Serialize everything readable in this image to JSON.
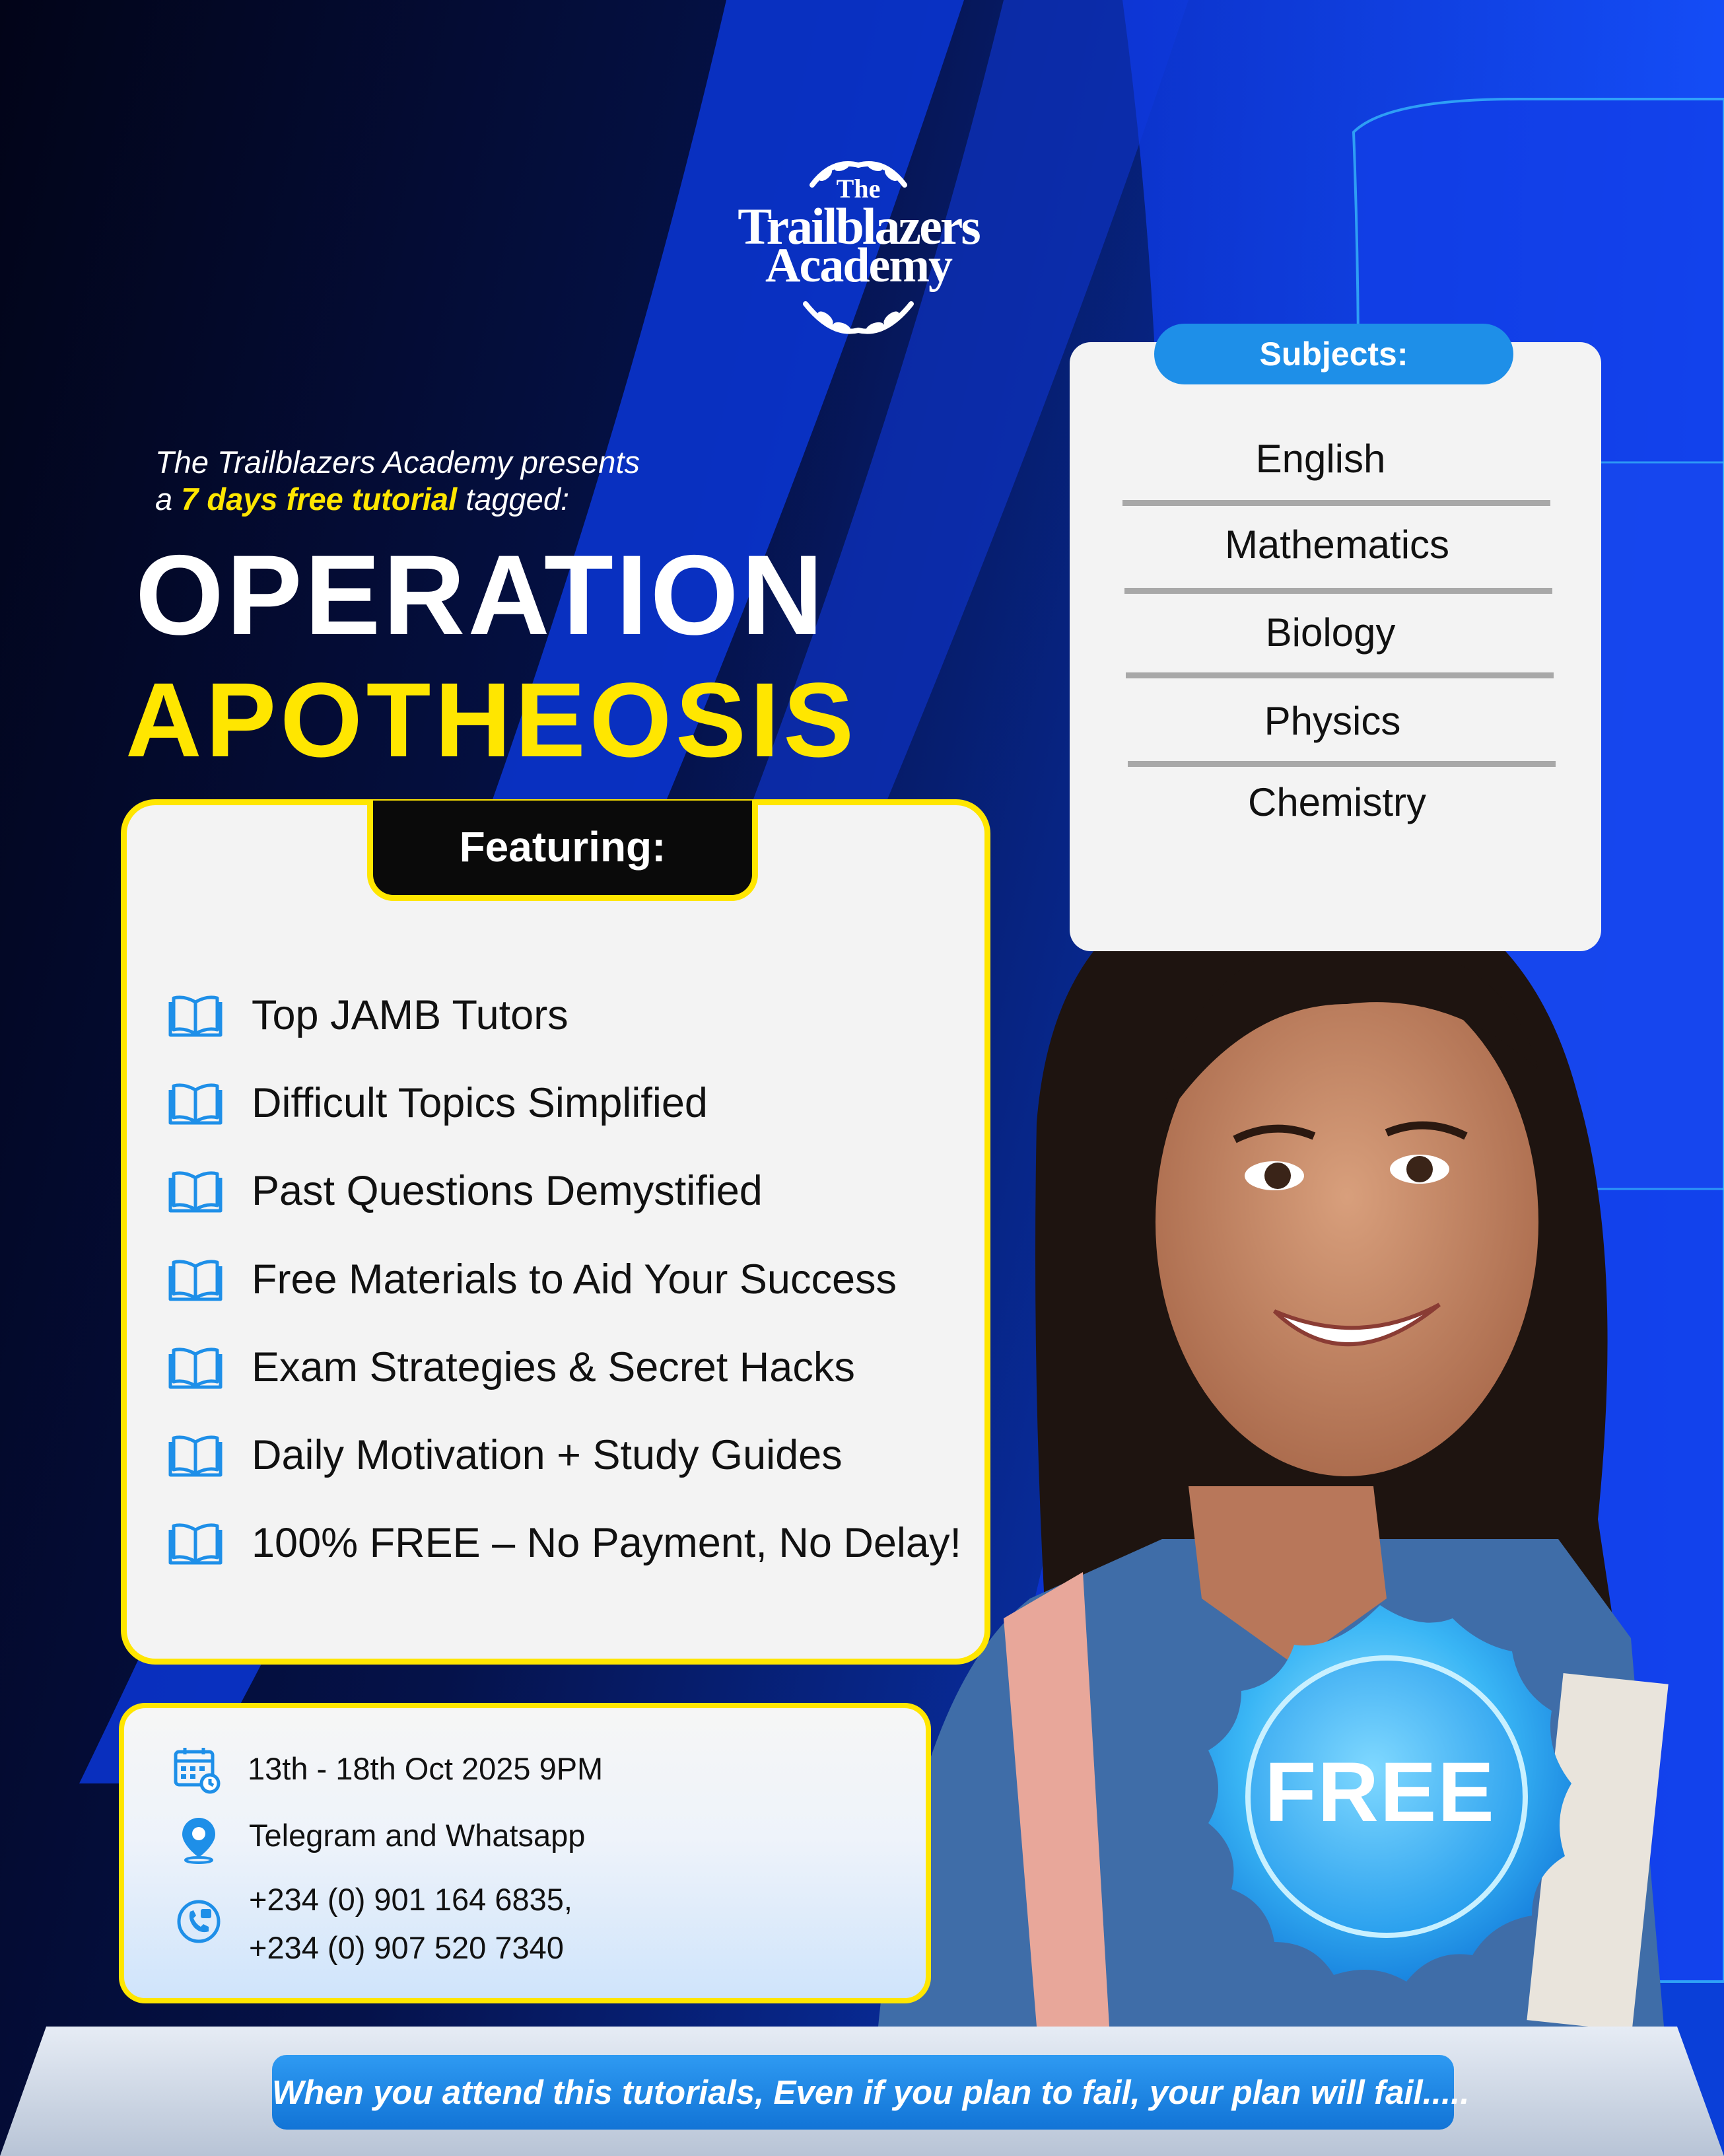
{
  "logo": {
    "the": "The",
    "name": "Trailblazers",
    "sub": "Academy"
  },
  "intro": {
    "line1": "The Trailblazers Academy presents",
    "line2_pre": "a ",
    "line2_highlight": "7 days free tutorial",
    "line2_post": " tagged:"
  },
  "title": {
    "line1": "OPERATION",
    "line2": "APOTHEOSIS"
  },
  "featuring": {
    "label": "Featuring:",
    "items": [
      "Top JAMB Tutors",
      "Difficult Topics Simplified",
      "Past Questions Demystified",
      "Free Materials to Aid Your Success",
      "Exam Strategies & Secret Hacks",
      "Daily Motivation + Study Guides",
      "100% FREE – No Payment, No Delay!"
    ],
    "icon": "book-icon"
  },
  "subjects": {
    "label": "Subjects:",
    "items": [
      "English",
      "Mathematics",
      "Biology",
      "Physics",
      "Chemistry"
    ]
  },
  "info": {
    "date": "13th - 18th Oct 2025 9PM",
    "platform": "Telegram and Whatsapp",
    "phone1": "+234 (0) 901 164 6835,",
    "phone2": "+234 (0) 907 520 7340",
    "icons": [
      "calendar-icon",
      "location-pin-icon",
      "phone-icon"
    ]
  },
  "seal": {
    "label": "FREE"
  },
  "banner": {
    "text": "When you attend this tutorials, Even if you plan to fail, your plan will fail....."
  },
  "colors": {
    "accent_yellow": "#ffe600",
    "accent_blue": "#1e8fe8",
    "background": "#030a2a"
  }
}
